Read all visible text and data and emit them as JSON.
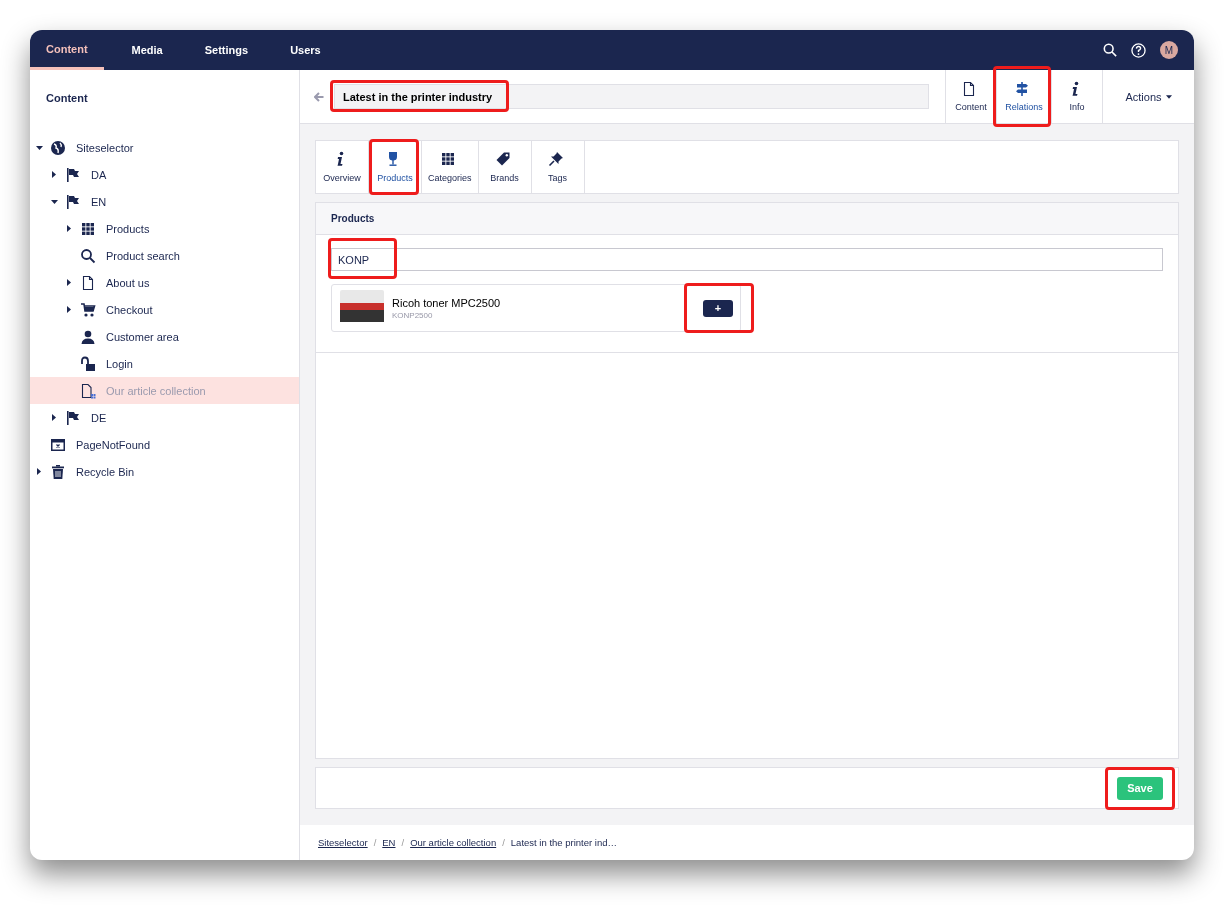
{
  "top_nav": {
    "sections": [
      {
        "label": "Content",
        "selected": true
      },
      {
        "label": "Media",
        "selected": false
      },
      {
        "label": "Settings",
        "selected": false
      },
      {
        "label": "Users",
        "selected": false
      }
    ],
    "avatar": "M"
  },
  "sidebar": {
    "title": "Content",
    "tree": [
      {
        "label": "Siteselector",
        "kind": "site",
        "expanded": true,
        "selected": false,
        "children": [
          {
            "label": "DA",
            "kind": "language",
            "expanded": false,
            "selected": false
          },
          {
            "label": "EN",
            "kind": "language",
            "expanded": true,
            "selected": false,
            "children": [
              {
                "label": "Products",
                "kind": "catalog",
                "expanded": false,
                "selected": false
              },
              {
                "label": "Product search",
                "kind": "search",
                "selected": false
              },
              {
                "label": "About us",
                "kind": "page",
                "expanded": false,
                "selected": false
              },
              {
                "label": "Checkout",
                "kind": "cart",
                "expanded": false,
                "selected": false
              },
              {
                "label": "Customer area",
                "kind": "person",
                "selected": false
              },
              {
                "label": "Login",
                "kind": "lock",
                "selected": false
              },
              {
                "label": "Our article collection",
                "kind": "collection",
                "selected": true
              }
            ]
          },
          {
            "label": "DE",
            "kind": "language",
            "expanded": false,
            "selected": false
          }
        ]
      },
      {
        "label": "PageNotFound",
        "kind": "error",
        "selected": false
      },
      {
        "label": "Recycle Bin",
        "kind": "bin",
        "expanded": false,
        "selected": false
      }
    ]
  },
  "editor": {
    "title": {
      "value": "Latest in the printer industry",
      "highlighted": true
    },
    "apps": [
      {
        "label": "Content",
        "kind": "page",
        "selected": false,
        "highlighted": false
      },
      {
        "label": "Relations",
        "kind": "signpost",
        "selected": true,
        "highlighted": true
      },
      {
        "label": "Info",
        "kind": "info",
        "selected": false,
        "highlighted": false
      }
    ],
    "actions": "Actions",
    "tabs": [
      {
        "label": "Overview",
        "kind": "info",
        "selected": false,
        "highlighted": false
      },
      {
        "label": "Products",
        "kind": "glass",
        "selected": true,
        "highlighted": true
      },
      {
        "label": "Categories",
        "kind": "grid",
        "selected": false,
        "highlighted": false
      },
      {
        "label": "Brands",
        "kind": "tag",
        "selected": false,
        "highlighted": false
      },
      {
        "label": "Tags",
        "kind": "pin",
        "selected": false,
        "highlighted": false
      }
    ],
    "panel": {
      "title": "Products",
      "search": {
        "value": "KONP",
        "highlighted": true
      },
      "results": [
        {
          "name": "Ricoh toner MPC2500",
          "sku": "KONP2500",
          "add_button": "+",
          "highlighted": true
        }
      ]
    },
    "save": {
      "label": "Save",
      "highlighted": true
    }
  },
  "breadcrumb": [
    {
      "label": "Siteselector",
      "link": true
    },
    {
      "separator": "/",
      "label": "EN",
      "link": true
    },
    {
      "separator": "/",
      "label": "Our article collection",
      "link": true
    },
    {
      "separator": "/",
      "label": "Latest in the printer ind…",
      "link": false
    }
  ]
}
